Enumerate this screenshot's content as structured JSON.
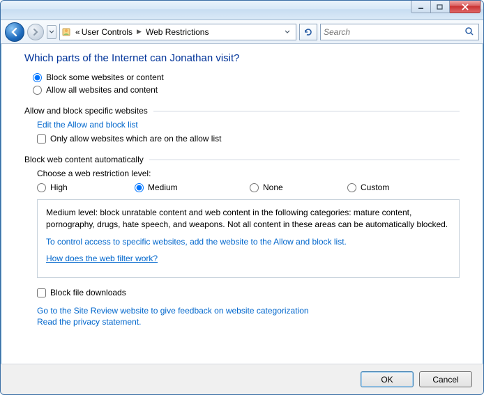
{
  "titlebar": {},
  "nav": {
    "breadcrumb_prefix": "«",
    "crumb1": "User Controls",
    "crumb2": "Web Restrictions"
  },
  "search": {
    "placeholder": "Search"
  },
  "page": {
    "title": "Which parts of the Internet can Jonathan visit?",
    "mode": {
      "block_label": "Block some websites or content",
      "allow_label": "Allow all websites and content",
      "selected": "block"
    }
  },
  "allow_block_group": {
    "header": "Allow and block specific websites",
    "edit_link": "Edit the Allow and block list",
    "only_allow_label": "Only allow websites which are on the allow list",
    "only_allow_checked": false
  },
  "auto_group": {
    "header": "Block web content automatically",
    "choose_label": "Choose a web restriction level:",
    "levels": {
      "high": "High",
      "medium": "Medium",
      "none": "None",
      "custom": "Custom",
      "selected": "medium"
    },
    "desc": "Medium level:  block unratable content and web content in the following categories:  mature content, pornography, drugs, hate speech, and weapons.  Not all content in these areas can be automatically blocked.",
    "desc_link": "To control access to specific websites, add the website to the Allow and block list.",
    "how_link": "How does the web filter work?"
  },
  "downloads": {
    "block_label": "Block file downloads",
    "checked": false
  },
  "footer": {
    "site_review": "Go to the Site Review website to give feedback on website categorization",
    "privacy": "Read the privacy statement."
  },
  "buttons": {
    "ok": "OK",
    "cancel": "Cancel"
  }
}
